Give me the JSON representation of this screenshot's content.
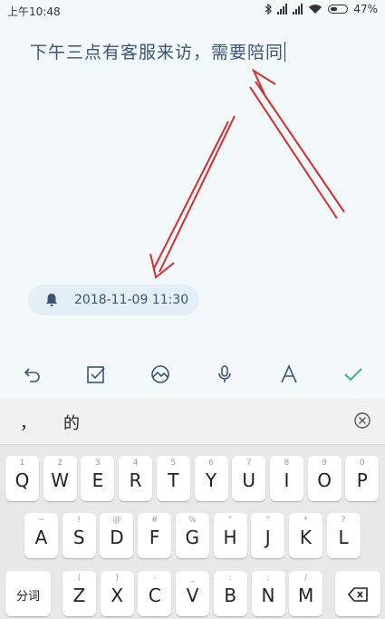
{
  "status": {
    "time": "上午10:48",
    "battery": "47%"
  },
  "note": {
    "text": "下午三点有客服来访，需要陪同"
  },
  "reminder": {
    "datetime": "2018-11-09 11:30"
  },
  "toolbar": {
    "icons": [
      "undo-icon",
      "checkbox-icon",
      "image-icon",
      "mic-icon",
      "font-icon",
      "check-icon"
    ]
  },
  "candidates": {
    "c1": "，",
    "c2": "的"
  },
  "keyboard": {
    "row1": [
      {
        "k": "Q",
        "s": "1"
      },
      {
        "k": "W",
        "s": "2"
      },
      {
        "k": "E",
        "s": "3"
      },
      {
        "k": "R",
        "s": "4"
      },
      {
        "k": "T",
        "s": "5"
      },
      {
        "k": "Y",
        "s": "6"
      },
      {
        "k": "U",
        "s": "7"
      },
      {
        "k": "I",
        "s": "8"
      },
      {
        "k": "O",
        "s": "9"
      },
      {
        "k": "P",
        "s": "0"
      }
    ],
    "row2": [
      {
        "k": "A",
        "s": "~"
      },
      {
        "k": "S",
        "s": "!"
      },
      {
        "k": "D",
        "s": "@"
      },
      {
        "k": "F",
        "s": "#"
      },
      {
        "k": "G",
        "s": "%"
      },
      {
        "k": "H",
        "s": "\""
      },
      {
        "k": "J",
        "s": "\""
      },
      {
        "k": "K",
        "s": "*"
      },
      {
        "k": "L",
        "s": "?"
      }
    ],
    "row3": [
      {
        "k": "Z",
        "s": "("
      },
      {
        "k": "X",
        "s": ")"
      },
      {
        "k": "C",
        "s": "-"
      },
      {
        "k": "V",
        "s": "_"
      },
      {
        "k": "B",
        "s": ":"
      },
      {
        "k": "N",
        "s": ";"
      },
      {
        "k": "M",
        "s": "/"
      }
    ],
    "fenci": "分词"
  },
  "colors": {
    "accent": "#3b5575",
    "check": "#3fae8a",
    "annotation": "#d32f2f"
  }
}
